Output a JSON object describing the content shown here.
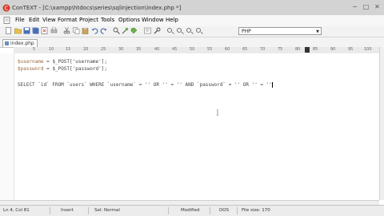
{
  "window": {
    "title": "ConTEXT - [C:\\xampp\\htdocs\\series\\sqlinjection\\index.php *]",
    "min_glyph": "─",
    "max_glyph": "□",
    "close_glyph": "✕"
  },
  "menu": [
    "File",
    "Edit",
    "View",
    "Format",
    "Project",
    "Tools",
    "Options",
    "Window",
    "Help"
  ],
  "toolbar": {
    "language_select": "PHP",
    "icons": [
      "new-file-icon",
      "open-icon",
      "save-icon",
      "save-all-icon",
      "close-icon",
      "print-icon",
      "cut-icon",
      "copy-icon",
      "paste-icon",
      "undo-icon",
      "redo-icon",
      "find-icon",
      "find-replace-icon",
      "bookmark-icon",
      "wordwrap-icon",
      "settings-icon",
      "macro-record-icon",
      "macro-play-icon",
      "macro-stop-icon",
      "macro-list-icon"
    ]
  },
  "tab": {
    "label": "index.php"
  },
  "ruler": {
    "labels": [
      "5",
      "10",
      "15",
      "20",
      "25",
      "30",
      "35",
      "40",
      "45",
      "50",
      "55",
      "60",
      "65",
      "70",
      "75",
      "80",
      "85",
      "90",
      "95",
      "100"
    ]
  },
  "code": {
    "line1": {
      "var": "$username",
      "rest": " = $_POST['username'];"
    },
    "line2": {
      "var": "$password",
      "rest": " = $_POST['password'];"
    },
    "line4": "SELECT `id` FROM `users` WHERE `username` = '' OR '' = '' AND `password` = '' OR '' = ''"
  },
  "status": {
    "position": "Ln 4, Col 81",
    "mode": "Insert",
    "sel": "Sel: Normal",
    "modified": "Modified",
    "format": "DOS",
    "filesize": "File size: 170"
  }
}
